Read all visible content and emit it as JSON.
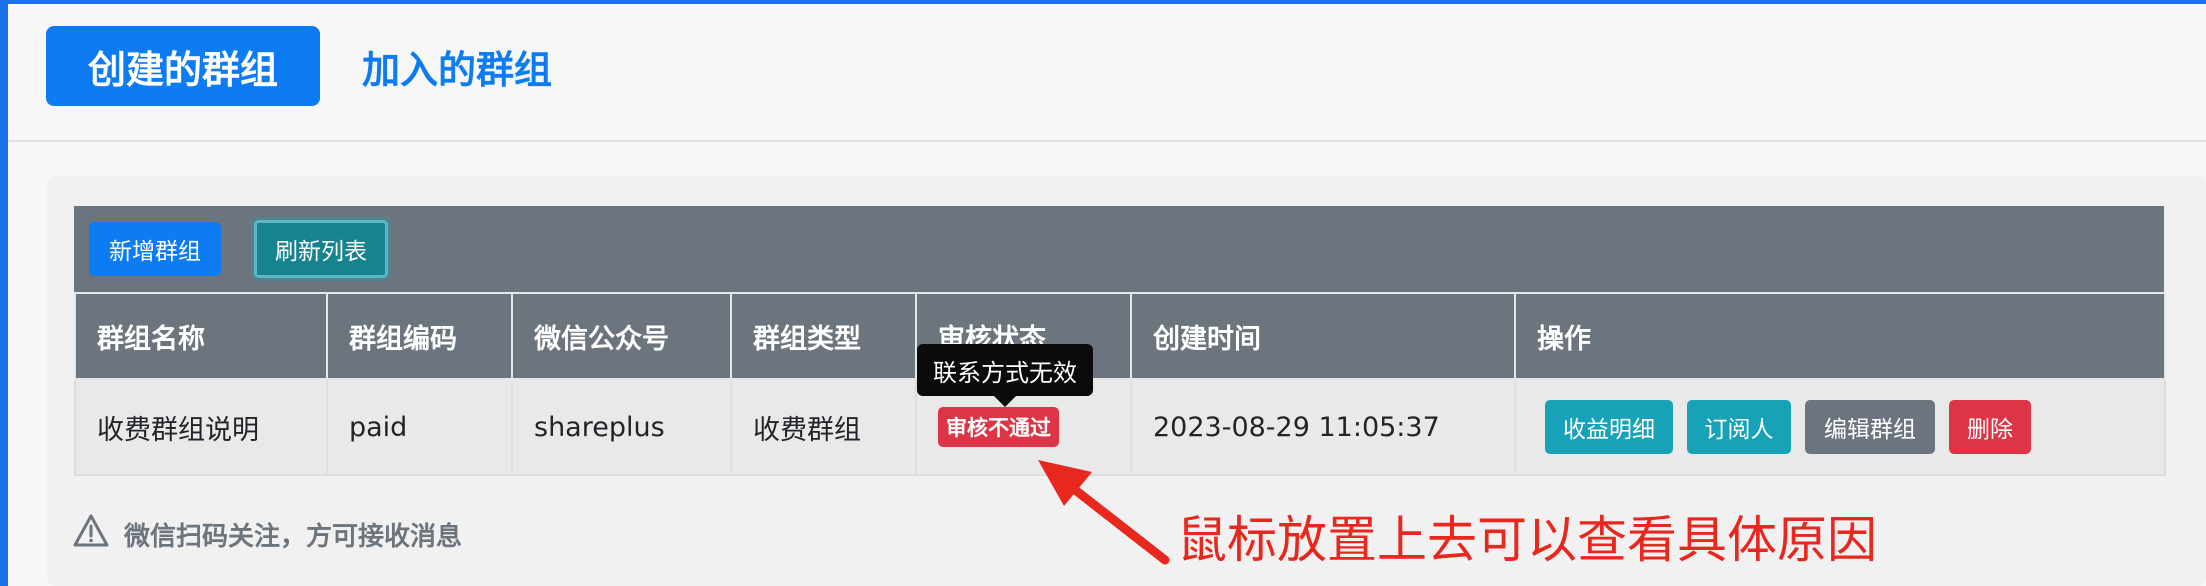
{
  "tabs": {
    "active": "创建的群组",
    "other": "加入的群组"
  },
  "toolbar": {
    "add_label": "新增群组",
    "refresh_label": "刷新列表"
  },
  "table": {
    "headers": [
      "群组名称",
      "群组编码",
      "微信公众号",
      "群组类型",
      "审核状态",
      "创建时间",
      "操作"
    ],
    "rows": [
      {
        "name": "收费群组说明",
        "code": "paid",
        "wechat": "shareplus",
        "type": "收费群组",
        "status": "审核不通过",
        "created": "2023-08-29 11:05:37",
        "actions": [
          "收益明细",
          "订阅人",
          "编辑群组",
          "删除"
        ]
      }
    ]
  },
  "tooltip": {
    "text": "联系方式无效"
  },
  "notice": {
    "text": "微信扫码关注，方可接收消息",
    "icon": "warning-triangle-icon"
  },
  "annotation": {
    "text": "鼠标放置上去可以查看具体原因",
    "color": "#e8281f"
  },
  "colors": {
    "primary": "#0d7bf2",
    "info": "#17a2b8",
    "secondary": "#6c757d",
    "danger": "#dc3545"
  }
}
